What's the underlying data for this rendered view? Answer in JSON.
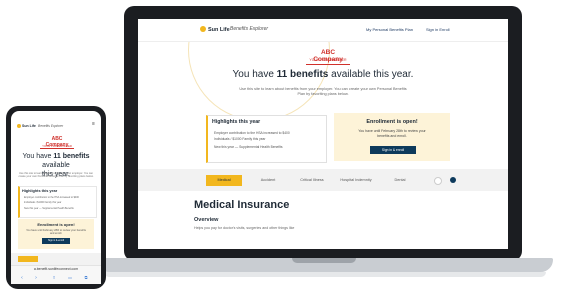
{
  "site": {
    "brand": "Sun Life",
    "product": "Benefits Explorer",
    "nav_links": [
      "My Personal Benefits Plan",
      "Sign in Enroll"
    ]
  },
  "company": {
    "name": "ABC Company",
    "tagline": "YOUR PLACEHOLDER"
  },
  "hero": {
    "prefix": "You have ",
    "count": "11 benefits",
    "suffix": " available this year.",
    "intro": "Use this site to learn about benefits from your employer. You can create your own Personal Benefits Plan by favoriting plans below."
  },
  "highlights": {
    "title": "Highlights this year",
    "items": [
      "Employer contribution to the HSA increased to $400",
      "Individuals / $1000 Family this year",
      "New this year — Supplemental Health Benefits"
    ]
  },
  "enrollment": {
    "title": "Enrollment is open!",
    "text": "You have until February 28th to review your benefits and enroll.",
    "button": "Sign in & enroll"
  },
  "tabs": [
    "Medical",
    "Accident",
    "Critical Illness",
    "Hospital Indemnity",
    "Dental"
  ],
  "active_tab": "Medical",
  "section": {
    "title": "Medical Insurance",
    "overview_title": "Overview",
    "overview_text": "Helps you pay for doctor's visits, surgeries and other things like"
  },
  "phone": {
    "headline_line1": "You have ",
    "headline_bold": "11 benefits",
    "headline_line2": " available",
    "headline_line3": "this year.",
    "url": "a.benefit.sunlifeconnect.com",
    "menu_icon": "hamburger-icon"
  },
  "colors": {
    "accent": "#f2b71e",
    "navy": "#0d3a5c",
    "company_red": "#d0302b",
    "enroll_bg": "#fdf3d8"
  }
}
